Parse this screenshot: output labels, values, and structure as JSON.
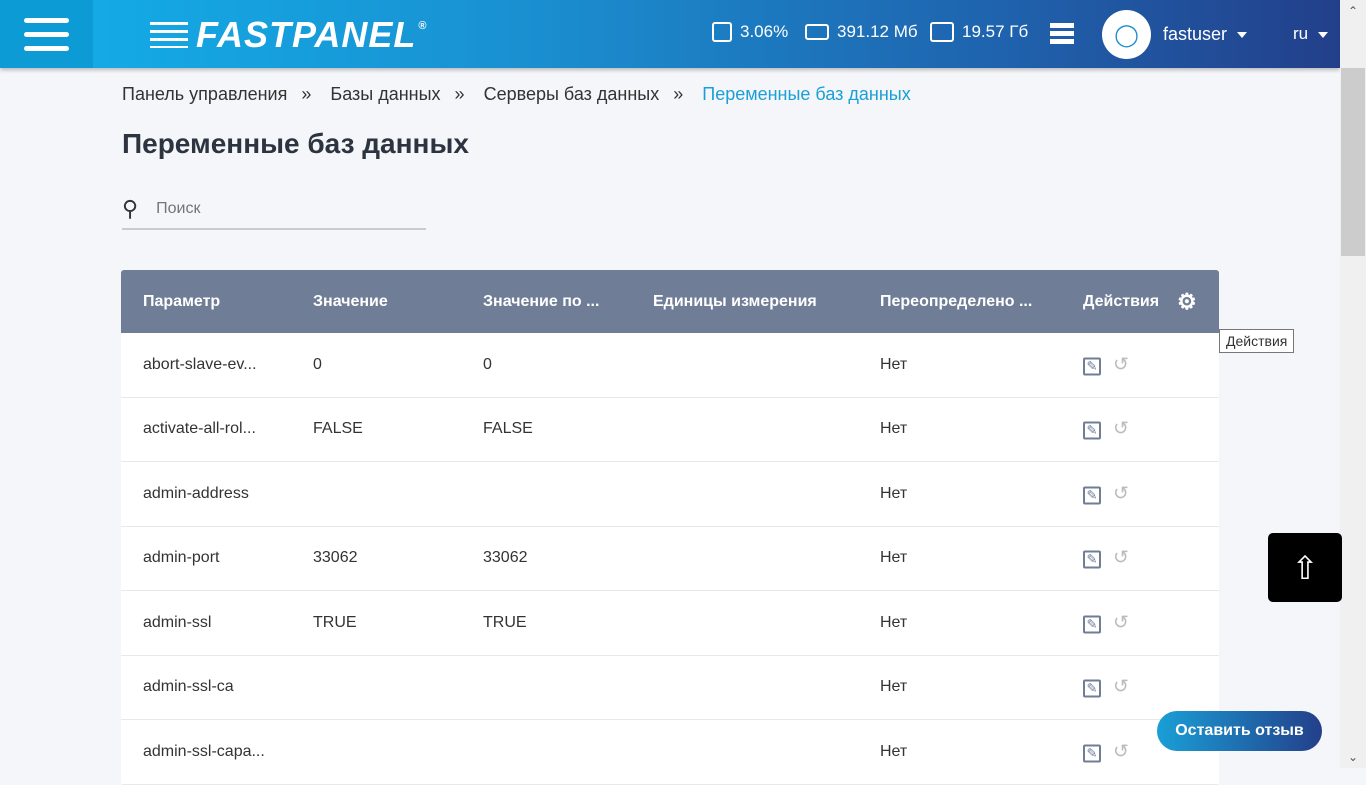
{
  "header": {
    "logo": "FASTPANEL",
    "cpu": "3.06%",
    "ram": "391.12 Мб",
    "disk": "19.57 Гб",
    "user": "fastuser",
    "lang": "ru"
  },
  "breadcrumbs": [
    "Панель управления",
    "Базы данных",
    "Серверы баз данных",
    "Переменные баз данных"
  ],
  "breadcrumb_sep": "»",
  "title": "Переменные баз данных",
  "search": {
    "placeholder": "Поиск"
  },
  "table": {
    "columns": [
      "Параметр",
      "Значение",
      "Значение по ...",
      "Единицы измерения",
      "Переопределено ...",
      "Действия"
    ],
    "rows": [
      {
        "param": "abort-slave-ev...",
        "value": "0",
        "default": "0",
        "units": "",
        "overridden": "Нет"
      },
      {
        "param": "activate-all-rol...",
        "value": "FALSE",
        "default": "FALSE",
        "units": "",
        "overridden": "Нет"
      },
      {
        "param": "admin-address",
        "value": "",
        "default": "",
        "units": "",
        "overridden": "Нет"
      },
      {
        "param": "admin-port",
        "value": "33062",
        "default": "33062",
        "units": "",
        "overridden": "Нет"
      },
      {
        "param": "admin-ssl",
        "value": "TRUE",
        "default": "TRUE",
        "units": "",
        "overridden": "Нет"
      },
      {
        "param": "admin-ssl-ca",
        "value": "",
        "default": "",
        "units": "",
        "overridden": "Нет"
      },
      {
        "param": "admin-ssl-capa...",
        "value": "",
        "default": "",
        "units": "",
        "overridden": "Нет"
      }
    ]
  },
  "tooltip": "Действия",
  "feedback_button": "Оставить отзыв"
}
